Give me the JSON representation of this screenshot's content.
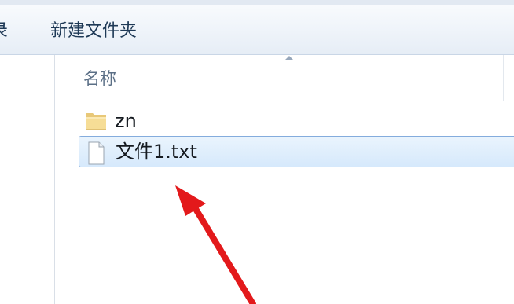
{
  "toolbar": {
    "partial_button_label": "录",
    "new_folder_label": "新建文件夹"
  },
  "list": {
    "column_name": "名称",
    "items": [
      {
        "label": "zn",
        "icon": "folder-icon"
      },
      {
        "label": "文件1.txt",
        "icon": "text-file-icon",
        "selected": true
      }
    ]
  },
  "colors": {
    "selection_fill": "#d6e9fc",
    "selection_border": "#84acdd",
    "annotation_arrow": "#e3191b"
  }
}
